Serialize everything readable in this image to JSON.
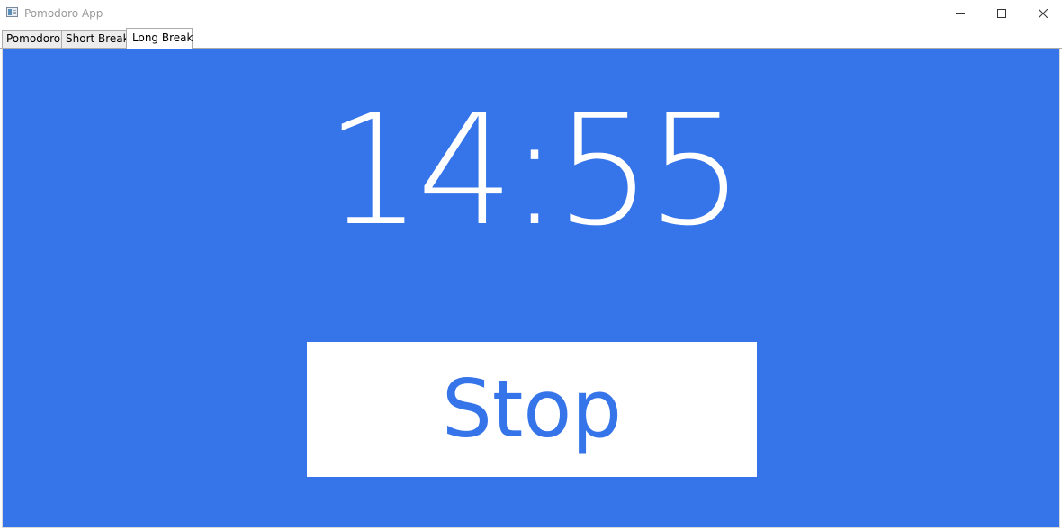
{
  "window": {
    "title": "Pomodoro App"
  },
  "tabs": [
    {
      "label": "Pomodoro",
      "selected": false
    },
    {
      "label": "Short Break",
      "selected": false
    },
    {
      "label": "Long Break",
      "selected": true
    }
  ],
  "timer": {
    "display": "14:55"
  },
  "controls": {
    "stop_label": "Stop"
  },
  "colors": {
    "panel_background": "#3574e9",
    "button_background": "#ffffff",
    "button_text": "#3574e9",
    "timer_text": "#ffffff"
  },
  "icons": {
    "app": "app-window-icon",
    "minimize": "minimize-icon",
    "maximize": "maximize-icon",
    "close": "close-icon"
  }
}
